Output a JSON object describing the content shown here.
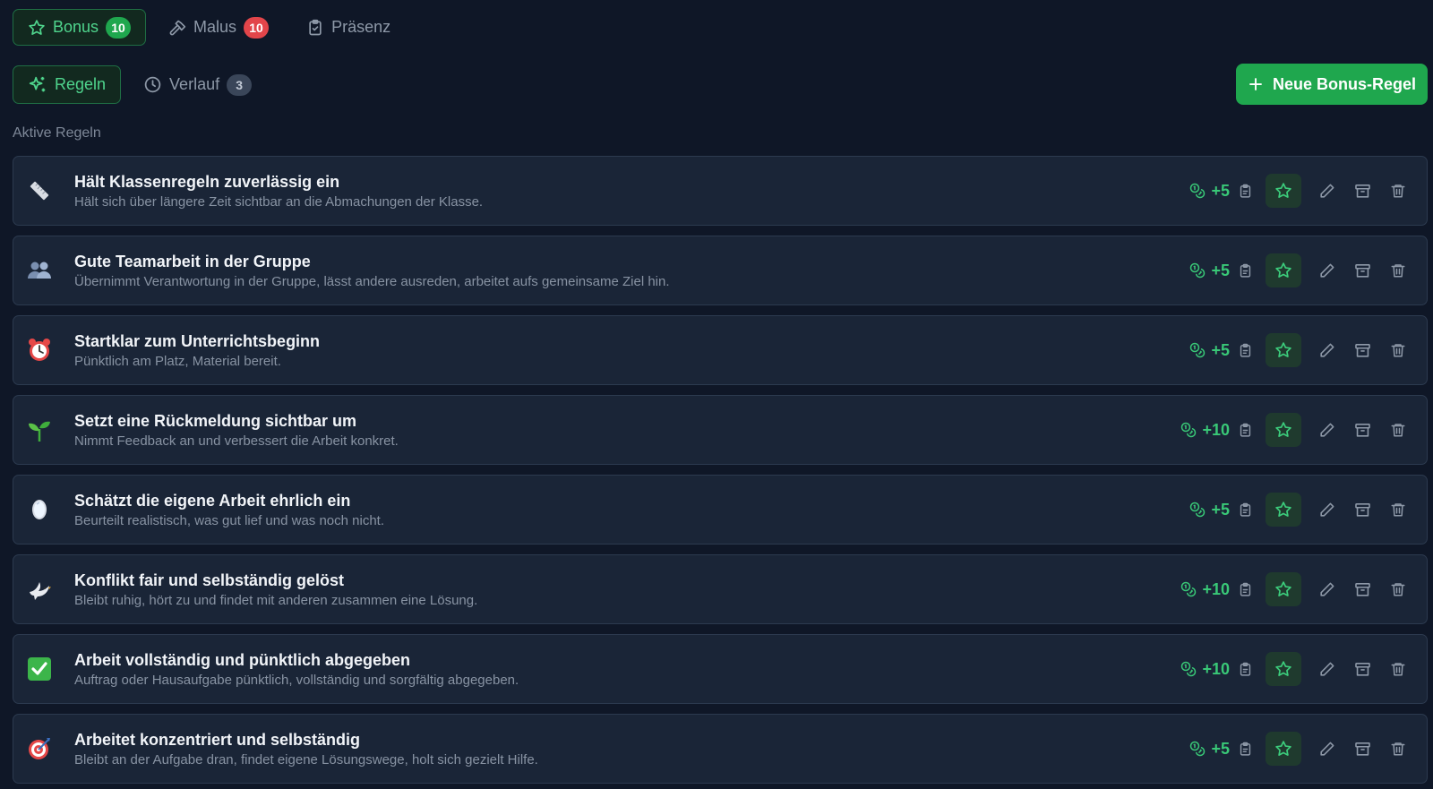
{
  "top_tabs": [
    {
      "label": "Bonus",
      "badge": "10",
      "icon": "star-icon",
      "active": true,
      "badge_color": "#1fa74e"
    },
    {
      "label": "Malus",
      "badge": "10",
      "icon": "hammer-icon",
      "active": false,
      "badge_color": "#e2454a"
    },
    {
      "label": "Präsenz",
      "icon": "clipboard-check-icon",
      "active": false
    }
  ],
  "sub_tabs": [
    {
      "label": "Regeln",
      "icon": "sparkles-icon",
      "active": true
    },
    {
      "label": "Verlauf",
      "badge": "3",
      "icon": "clock-icon",
      "active": false
    }
  ],
  "new_rule_button": {
    "label": "Neue Bonus-Regel",
    "icon": "plus-icon"
  },
  "section_title": "Aktive Regeln",
  "colors": {
    "accent": "#1fa74e",
    "points": "#39c877",
    "danger": "#e2454a",
    "background": "#0f1727",
    "card": "#1a2537"
  },
  "rules": [
    {
      "emoji": "ruler",
      "title": "Hält Klassenregeln zuverlässig ein",
      "description": "Hält sich über längere Zeit sichtbar an die Abmachungen der Klasse.",
      "points": "+5"
    },
    {
      "emoji": "people",
      "title": "Gute Teamarbeit in der Gruppe",
      "description": "Übernimmt Verantwortung in der Gruppe, lässt andere ausreden, arbeitet aufs gemeinsame Ziel hin.",
      "points": "+5"
    },
    {
      "emoji": "alarm-clock",
      "title": "Startklar zum Unterrichtsbeginn",
      "description": "Pünktlich am Platz, Material bereit.",
      "points": "+5"
    },
    {
      "emoji": "seedling",
      "title": "Setzt eine Rückmeldung sichtbar um",
      "description": "Nimmt Feedback an und verbessert die Arbeit konkret.",
      "points": "+10"
    },
    {
      "emoji": "mirror",
      "title": "Schätzt die eigene Arbeit ehrlich ein",
      "description": "Beurteilt realistisch, was gut lief und was noch nicht.",
      "points": "+5"
    },
    {
      "emoji": "dove",
      "title": "Konflikt fair und selbständig gelöst",
      "description": "Bleibt ruhig, hört zu und findet mit anderen zusammen eine Lösung.",
      "points": "+10"
    },
    {
      "emoji": "check-box",
      "title": "Arbeit vollständig und pünktlich abgegeben",
      "description": "Auftrag oder Hausaufgabe pünktlich, vollständig und sorgfältig abgegeben.",
      "points": "+10"
    },
    {
      "emoji": "target",
      "title": "Arbeitet konzentriert und selbständig",
      "description": "Bleibt an der Aufgabe dran, findet eigene Lösungswege, holt sich gezielt Hilfe.",
      "points": "+5"
    }
  ]
}
